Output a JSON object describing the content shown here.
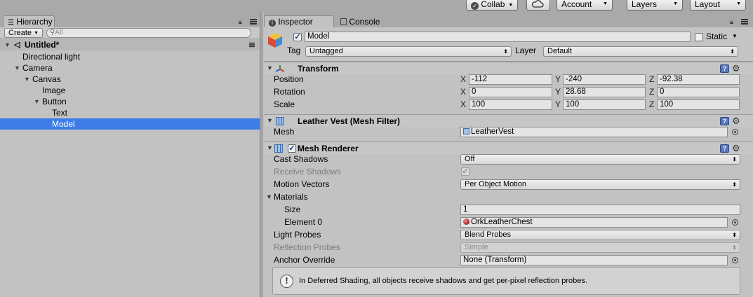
{
  "toolbar": {
    "collab_label": "Collab",
    "account_label": "Account",
    "layers_label": "Layers",
    "layout_label": "Layout"
  },
  "hierarchy": {
    "tab_label": "Hierarchy",
    "create_label": "Create",
    "search_placeholder": "All",
    "scene_name": "Untitled*",
    "items": [
      {
        "label": "Directional light"
      },
      {
        "label": "Camera"
      },
      {
        "label": "Canvas"
      },
      {
        "label": "Image"
      },
      {
        "label": "Button"
      },
      {
        "label": "Text"
      },
      {
        "label": "Model"
      }
    ],
    "selected_item": "Model"
  },
  "inspector": {
    "tab_label": "Inspector",
    "console_tab_label": "Console",
    "gameobject": {
      "active": true,
      "name": "Model",
      "static_label": "Static",
      "static_checked": false,
      "tag_label": "Tag",
      "tag_value": "Untagged",
      "layer_label": "Layer",
      "layer_value": "Default"
    },
    "transform": {
      "title": "Transform",
      "position_label": "Position",
      "rotation_label": "Rotation",
      "scale_label": "Scale",
      "axis_x": "X",
      "axis_y": "Y",
      "axis_z": "Z",
      "position": {
        "x": "-112",
        "y": "-240",
        "z": "-92.38"
      },
      "rotation": {
        "x": "0",
        "y": "28.68",
        "z": "0"
      },
      "scale": {
        "x": "100",
        "y": "100",
        "z": "100"
      }
    },
    "mesh_filter": {
      "title": "Leather Vest (Mesh Filter)",
      "mesh_label": "Mesh",
      "mesh_value": "LeatherVest"
    },
    "mesh_renderer": {
      "title": "Mesh Renderer",
      "enabled": true,
      "cast_shadows_label": "Cast Shadows",
      "cast_shadows_value": "Off",
      "receive_shadows_label": "Receive Shadows",
      "receive_shadows_checked": true,
      "motion_vectors_label": "Motion Vectors",
      "motion_vectors_value": "Per Object Motion",
      "materials_label": "Materials",
      "size_label": "Size",
      "size_value": "1",
      "element0_label": "Element 0",
      "element0_value": "OrkLeatherChest",
      "light_probes_label": "Light Probes",
      "light_probes_value": "Blend Probes",
      "reflection_probes_label": "Reflection Probes",
      "reflection_probes_value": "Simple",
      "anchor_override_label": "Anchor Override",
      "anchor_override_value": "None (Transform)",
      "help_text": "In Deferred Shading, all objects receive shadows and get per-pixel reflection probes."
    }
  },
  "icons": {
    "help": "help-book-icon",
    "settings": "gear-icon",
    "object_picker": "object-picker-icon",
    "lock": "lock-icon",
    "menu": "panel-menu-icon",
    "cloud": "cloud-icon"
  },
  "colors": {
    "selection": "#3e7de7",
    "panel_bg": "#c2c2c2",
    "toolbar_bg": "#a9a9a9",
    "help_icon_blue": "#5778b8"
  }
}
